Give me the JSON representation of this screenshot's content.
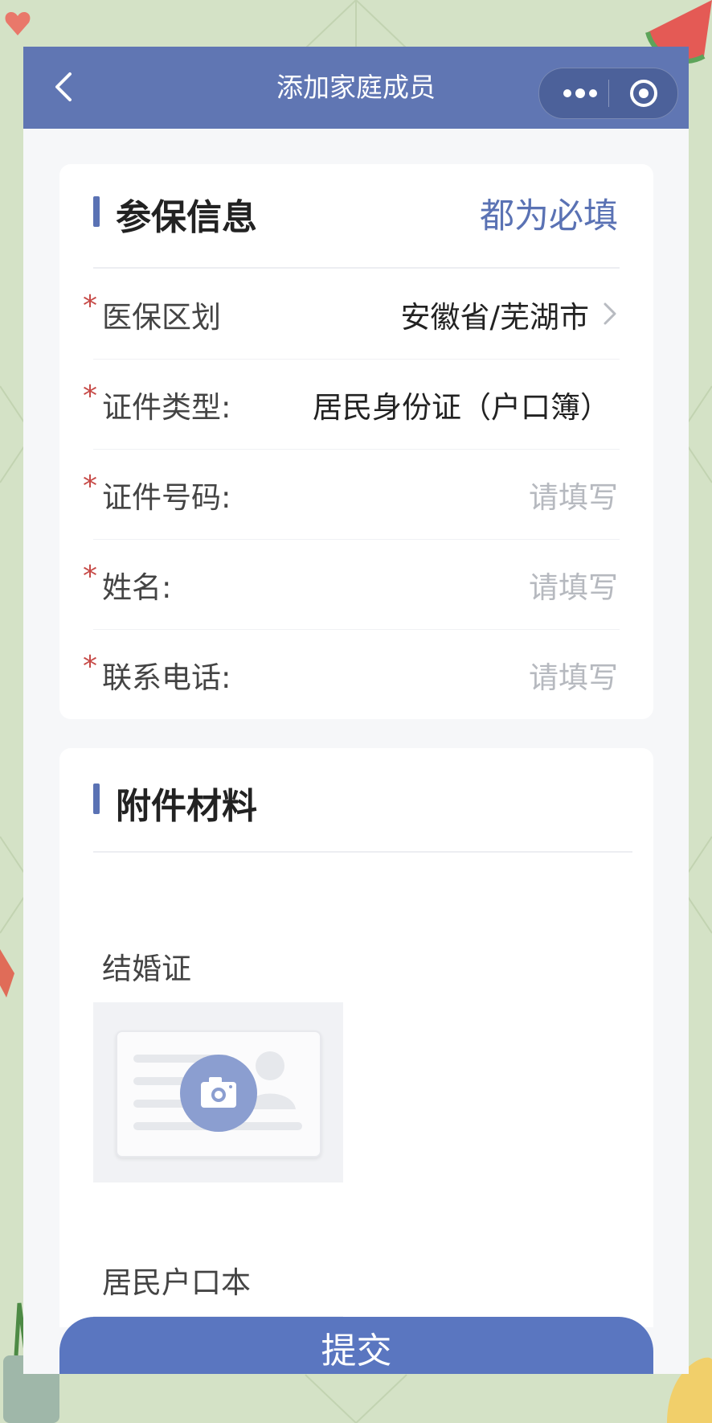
{
  "navbar": {
    "title": "添加家庭成员",
    "back_icon": "chevron-left-icon",
    "more_icon": "more-dots-icon",
    "close_icon": "target-close-icon"
  },
  "insurance_section": {
    "title": "参保信息",
    "required_note": "都为必填",
    "fields": [
      {
        "required": "*",
        "label": "医保区划",
        "value": "安徽省/芜湖市",
        "has_chevron": true
      },
      {
        "required": "*",
        "label": "证件类型:",
        "value": "居民身份证（户口簿）"
      },
      {
        "required": "*",
        "label": "证件号码:",
        "placeholder": "请填写"
      },
      {
        "required": "*",
        "label": "姓名:",
        "placeholder": "请填写"
      },
      {
        "required": "*",
        "label": "联系电话:",
        "placeholder": "请填写"
      }
    ]
  },
  "attachments_section": {
    "title": "附件材料",
    "items": [
      {
        "label": "结婚证",
        "upload_icon": "camera-icon"
      },
      {
        "label": "居民户口本",
        "upload_icon": "camera-icon"
      }
    ]
  },
  "submit": {
    "label": "提交"
  },
  "colors": {
    "primary": "#5a76c0",
    "navbar": "#6076b3",
    "required_star": "#c74b48",
    "background": "#d4e2c6"
  }
}
